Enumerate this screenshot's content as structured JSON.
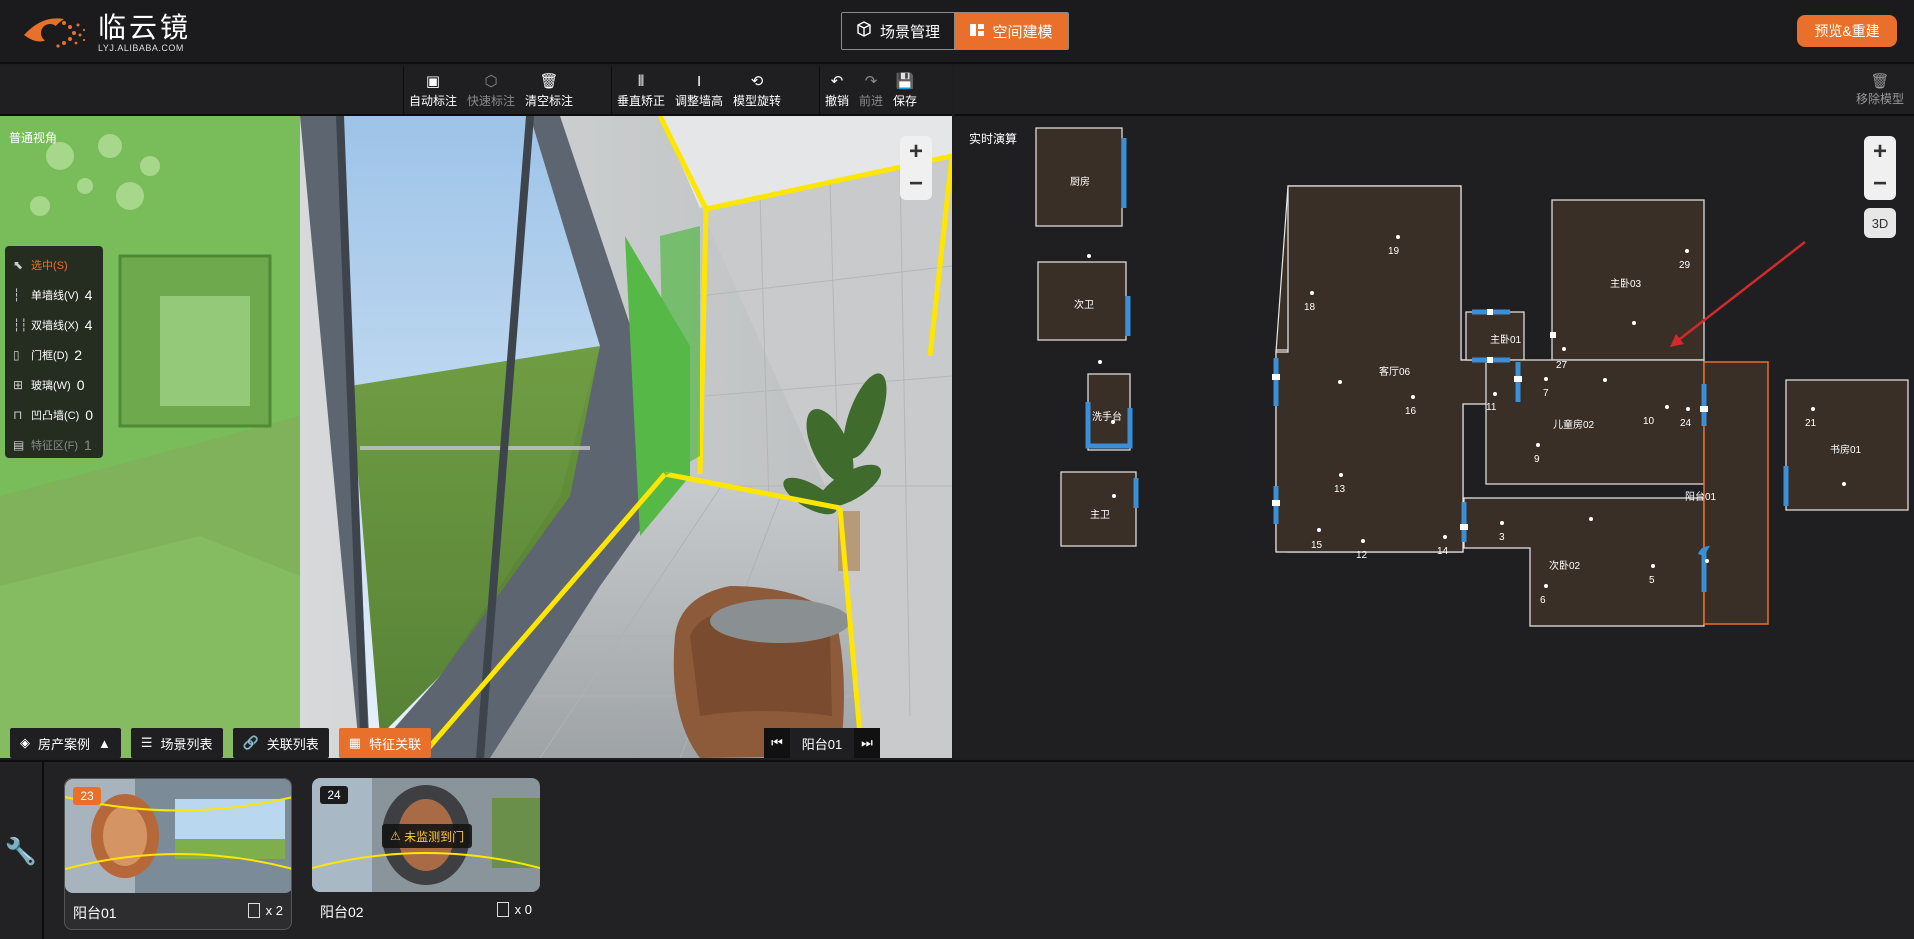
{
  "header": {
    "logo_cn": "临云镜",
    "logo_en": "LYJ.ALIBABA.COM",
    "mode_scene": "场景管理",
    "mode_space": "空间建模",
    "preview_rebuild": "预览&重建"
  },
  "toolbar": {
    "auto_mark": "自动标注",
    "quick_mark": "快速标注",
    "clear_mark": "清空标注",
    "vertical_fix": "垂直矫正",
    "adjust_wall": "调整墙高",
    "rotate_model": "模型旋转",
    "undo": "撤销",
    "redo": "前进",
    "save": "保存",
    "remove_model": "移除模型"
  },
  "pano": {
    "view_label": "普通视角",
    "counts": [
      {
        "label": "选中(S)",
        "value": ""
      },
      {
        "label": "单墙线(V)",
        "value": "4"
      },
      {
        "label": "双墙线(X)",
        "value": "4"
      },
      {
        "label": "门框(D)",
        "value": "2"
      },
      {
        "label": "玻璃(W)",
        "value": "0"
      },
      {
        "label": "凹凸墙(C)",
        "value": "0"
      },
      {
        "label": "特征区(F)",
        "value": "1"
      }
    ],
    "tabs": {
      "house_case": "房产案例",
      "scene_list": "场景列表",
      "link_list": "关联列表",
      "feature_link": "特征关联"
    },
    "current_scene": "阳台01"
  },
  "plan": {
    "label": "实时演算",
    "btn_3d": "3D",
    "rooms": {
      "kitchen": "厨房",
      "second_bath": "次卫",
      "washbasin": "洗手台",
      "master_bath": "主卫",
      "living": "客厅06",
      "master01": "主卧01",
      "master03": "主卧03",
      "kids": "儿童房02",
      "second_bed": "次卧02",
      "balcony": "阳台01",
      "study": "书房01"
    },
    "points": [
      "19",
      "18",
      "16",
      "13",
      "15",
      "12",
      "14",
      "29",
      "27",
      "11",
      "7",
      "10",
      "9",
      "24",
      "3",
      "5",
      "6",
      "21"
    ]
  },
  "thumbs": [
    {
      "badge": "23",
      "name": "阳台01",
      "doors": "x 2"
    },
    {
      "badge": "24",
      "name": "阳台02",
      "doors": "x 0",
      "warning": "未监测到门"
    }
  ],
  "colors": {
    "accent": "#e8702a",
    "wall_green": "#4fa83a",
    "edge_yellow": "#ffe600",
    "window_blue": "#3a8fd6",
    "room_fill": "#3a2f27"
  }
}
